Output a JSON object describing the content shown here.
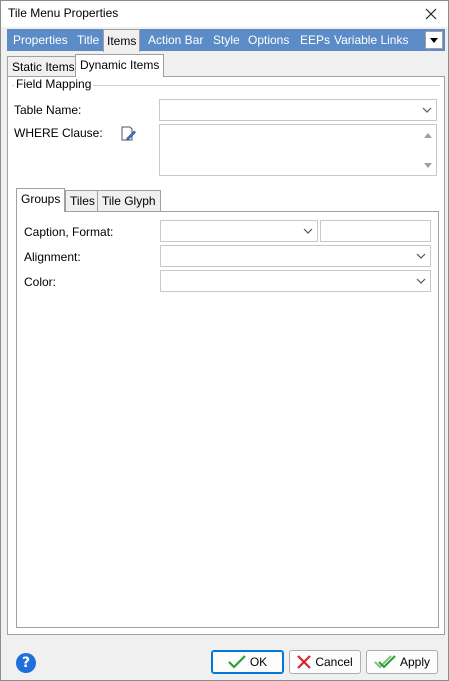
{
  "window": {
    "title": "Tile Menu Properties"
  },
  "main_tabs": [
    {
      "label": "Properties"
    },
    {
      "label": "Title"
    },
    {
      "label": "Items"
    },
    {
      "label": "Action Bar"
    },
    {
      "label": "Style"
    },
    {
      "label": "Options"
    },
    {
      "label": "EEPs"
    },
    {
      "label": "Variable Links"
    }
  ],
  "sub_tabs": [
    {
      "label": "Static Items"
    },
    {
      "label": "Dynamic Items"
    }
  ],
  "field_mapping": {
    "title": "Field Mapping",
    "table_name_label": "Table Name:",
    "table_name_value": "",
    "where_clause_label": "WHERE Clause:",
    "where_clause_value": ""
  },
  "inner_tabs": [
    {
      "label": "Groups"
    },
    {
      "label": "Tiles"
    },
    {
      "label": "Tile Glyph"
    }
  ],
  "groups": {
    "caption_label": "Caption, Format:",
    "caption_value": "",
    "format_value": "",
    "alignment_label": "Alignment:",
    "alignment_value": "",
    "color_label": "Color:",
    "color_value": ""
  },
  "buttons": {
    "help": "?",
    "ok": "OK",
    "cancel": "Cancel",
    "apply": "Apply"
  },
  "colors": {
    "tab_strip": "#5b8cc7",
    "ok_check": "#2e9e2e",
    "cancel_x": "#d42a2a",
    "help_bg": "#1e6fd9"
  }
}
